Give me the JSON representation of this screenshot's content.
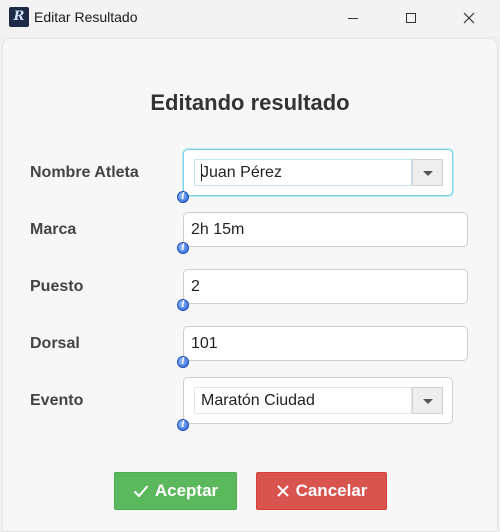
{
  "window": {
    "title": "Editar Resultado",
    "app_icon_letter": "R"
  },
  "form": {
    "heading": "Editando resultado",
    "fields": [
      {
        "label": "Nombre Atleta",
        "value": "Juan Pérez",
        "type": "combobox",
        "focused": true
      },
      {
        "label": "Marca",
        "value": "2h 15m",
        "type": "text"
      },
      {
        "label": "Puesto",
        "value": "2",
        "type": "text"
      },
      {
        "label": "Dorsal",
        "value": "101",
        "type": "text"
      },
      {
        "label": "Evento",
        "value": "Maratón Ciudad",
        "type": "combobox"
      }
    ],
    "info_icon_glyph": "i"
  },
  "buttons": {
    "accept": "Aceptar",
    "cancel": "Cancelar"
  },
  "colors": {
    "accept": "#5cb85c",
    "cancel": "#d9534f",
    "focus": "#7dd3e3"
  }
}
